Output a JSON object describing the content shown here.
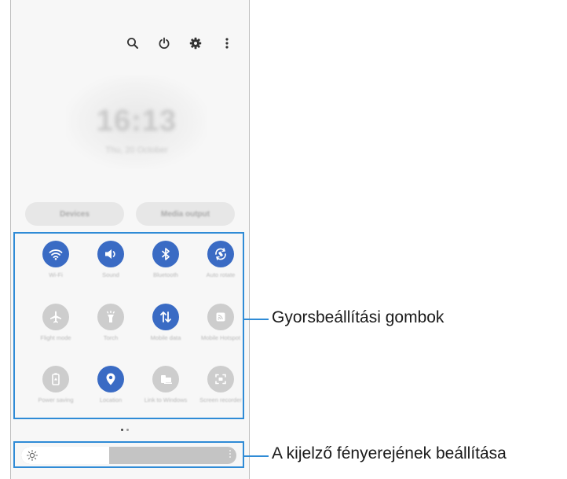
{
  "top_icons": [
    "search-icon",
    "power-icon",
    "settings-gear-icon",
    "more-options-icon"
  ],
  "clock": {
    "time": "16:13",
    "date": "Thu, 20 October"
  },
  "buttons": {
    "devices": "Devices",
    "media_output": "Media output"
  },
  "quick_settings": [
    {
      "label": "Wi-Fi",
      "icon": "wifi-icon",
      "state": "on"
    },
    {
      "label": "Sound",
      "icon": "sound-icon",
      "state": "on"
    },
    {
      "label": "Bluetooth",
      "icon": "bluetooth-icon",
      "state": "on"
    },
    {
      "label": "Auto rotate",
      "icon": "auto-rotate-icon",
      "state": "on"
    },
    {
      "label": "Flight mode",
      "icon": "airplane-icon",
      "state": "off"
    },
    {
      "label": "Torch",
      "icon": "torch-icon",
      "state": "off"
    },
    {
      "label": "Mobile data",
      "icon": "mobile-data-icon",
      "state": "on"
    },
    {
      "label": "Mobile Hotspot",
      "icon": "hotspot-icon",
      "state": "off"
    },
    {
      "label": "Power saving",
      "icon": "power-saving-icon",
      "state": "off"
    },
    {
      "label": "Location",
      "icon": "location-icon",
      "state": "on"
    },
    {
      "label": "Link to Windows",
      "icon": "link-to-windows-icon",
      "state": "off"
    },
    {
      "label": "Screen recorder",
      "icon": "screen-recorder-icon",
      "state": "off"
    }
  ],
  "page_indicator": {
    "pages": 2,
    "current": 1
  },
  "brightness": {
    "level": 0.41
  },
  "callouts": {
    "quick_settings": "Gyorsbeállítási gombok",
    "brightness": "A kijelző fényerejének beállítása"
  },
  "colors": {
    "accent": "#3a6bc4",
    "inactive": "#cdcdcd",
    "callout_line": "#2f8bd6"
  }
}
